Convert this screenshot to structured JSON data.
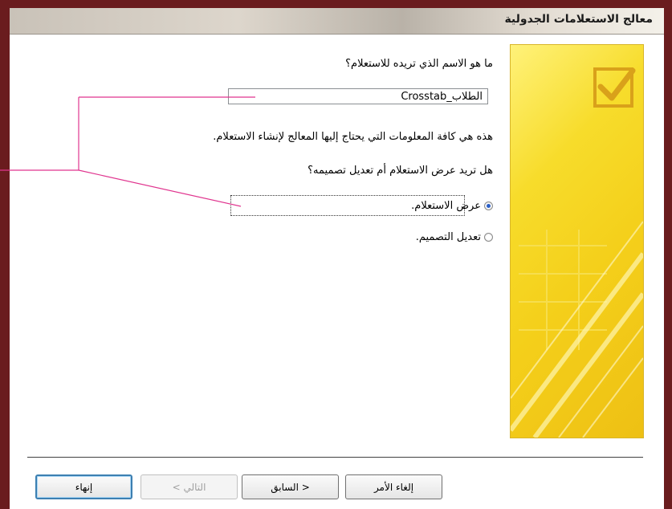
{
  "window": {
    "title": "معالج الاستعلامات الجدولية"
  },
  "wizard": {
    "name_prompt": "ما هو الاسم الذي تريده للاستعلام؟",
    "name_value": "الطلاب_Crosstab",
    "info_text": "هذه هي كافة المعلومات التي يحتاج إليها المعالج لإنشاء الاستعلام.",
    "question": "هل تريد عرض الاستعلام أم تعديل تصميمه؟",
    "options": [
      {
        "label": "عرض الاستعلام.",
        "checked": true
      },
      {
        "label": "تعديل التصميم.",
        "checked": false
      }
    ]
  },
  "buttons": {
    "cancel": "إلغاء الأمر",
    "back": "< السابق",
    "next": "التالي >",
    "finish": "إنهاء"
  },
  "colors": {
    "annotation_line": "#e0358f",
    "panel_yellow": "#f4cf1a",
    "frame": "#6a1c1e"
  }
}
